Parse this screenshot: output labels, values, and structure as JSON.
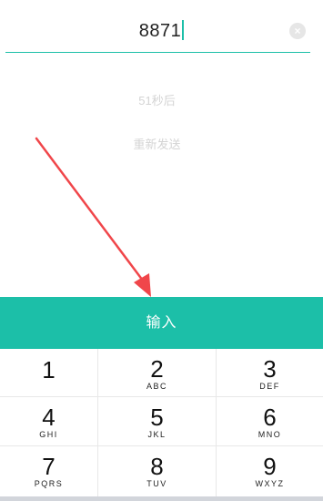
{
  "code_input": {
    "value": "8871"
  },
  "countdown_text": "51秒后",
  "resend_label": "重新发送",
  "submit_label": "输入",
  "colors": {
    "accent": "#1cbfa8",
    "arrow": "#f0464a"
  },
  "keypad": {
    "keys": [
      {
        "digit": "1",
        "letters": ""
      },
      {
        "digit": "2",
        "letters": "ABC"
      },
      {
        "digit": "3",
        "letters": "DEF"
      },
      {
        "digit": "4",
        "letters": "GHI"
      },
      {
        "digit": "5",
        "letters": "JKL"
      },
      {
        "digit": "6",
        "letters": "MNO"
      },
      {
        "digit": "7",
        "letters": "PQRS"
      },
      {
        "digit": "8",
        "letters": "TUV"
      },
      {
        "digit": "9",
        "letters": "WXYZ"
      }
    ]
  }
}
